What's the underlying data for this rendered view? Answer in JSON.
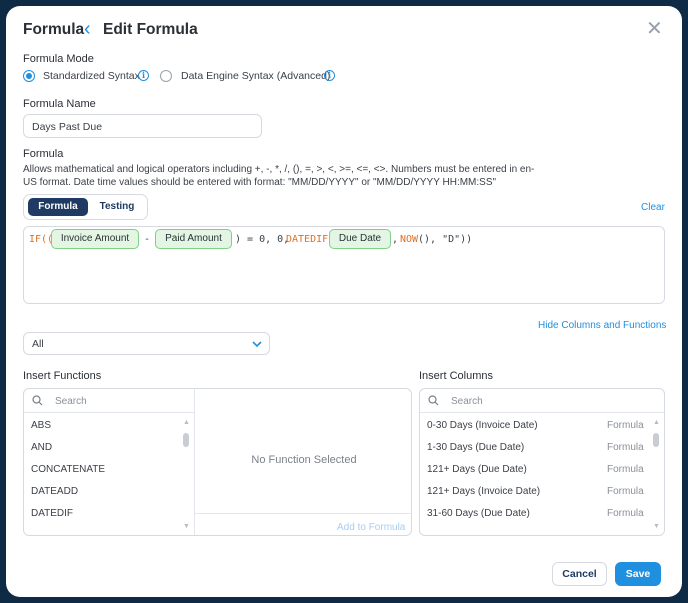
{
  "header": {
    "title": "Formula",
    "back_icon": "chevron-left-icon",
    "subtitle": "Edit Formula",
    "close_icon": "close-icon"
  },
  "mode": {
    "label": "Formula Mode",
    "options": [
      {
        "label": "Standardized Syntax",
        "selected": true
      },
      {
        "label": "Data Engine Syntax (Advanced)",
        "selected": false
      }
    ]
  },
  "name": {
    "label": "Formula Name",
    "value": "Days Past Due"
  },
  "formula": {
    "label": "Formula",
    "help_line1": "Allows mathematical and logical operators including +, -, *, /, (), =, >, <, >=, <=, <>. Numbers must be entered in en-",
    "help_line2": "US format. Date time values should be entered with format: \"MM/DD/YYYY\" or \"MM/DD/YYYY HH:MM:SS\"",
    "tabs": [
      "Formula",
      "Testing"
    ],
    "clear_label": "Clear",
    "tokens": {
      "if": "IF((",
      "chip1": "Invoice Amount",
      "minus": "-",
      "chip2": "Paid Amount",
      "mid": ") = 0, 0,",
      "datediff": "DATEDIF(",
      "chip3": "Due Date",
      "comma": ",",
      "now": "NOW",
      "tail": "(), \"D\"))"
    }
  },
  "toggle_link": "Hide Columns and Functions",
  "category_select": {
    "value": "All"
  },
  "functions": {
    "label": "Insert Functions",
    "search_placeholder": "Search",
    "items": [
      "ABS",
      "AND",
      "CONCATENATE",
      "DATEADD",
      "DATEDIF"
    ],
    "empty_text": "No Function Selected",
    "add_label": "Add to Formula"
  },
  "columns": {
    "label": "Insert Columns",
    "search_placeholder": "Search",
    "items": [
      {
        "name": "0-30 Days (Invoice Date)",
        "type": "Formula"
      },
      {
        "name": "1-30 Days (Due Date)",
        "type": "Formula"
      },
      {
        "name": "121+ Days (Due Date)",
        "type": "Formula"
      },
      {
        "name": "121+ Days (Invoice Date)",
        "type": "Formula"
      },
      {
        "name": "31-60 Days (Due Date)",
        "type": "Formula"
      }
    ]
  },
  "footer": {
    "cancel_label": "Cancel",
    "save_label": "Save"
  },
  "colors": {
    "accent": "#1f8fe0",
    "navy": "#1f3a63",
    "chip_bg": "#e3f6e3",
    "function_orange": "#e0701f"
  }
}
